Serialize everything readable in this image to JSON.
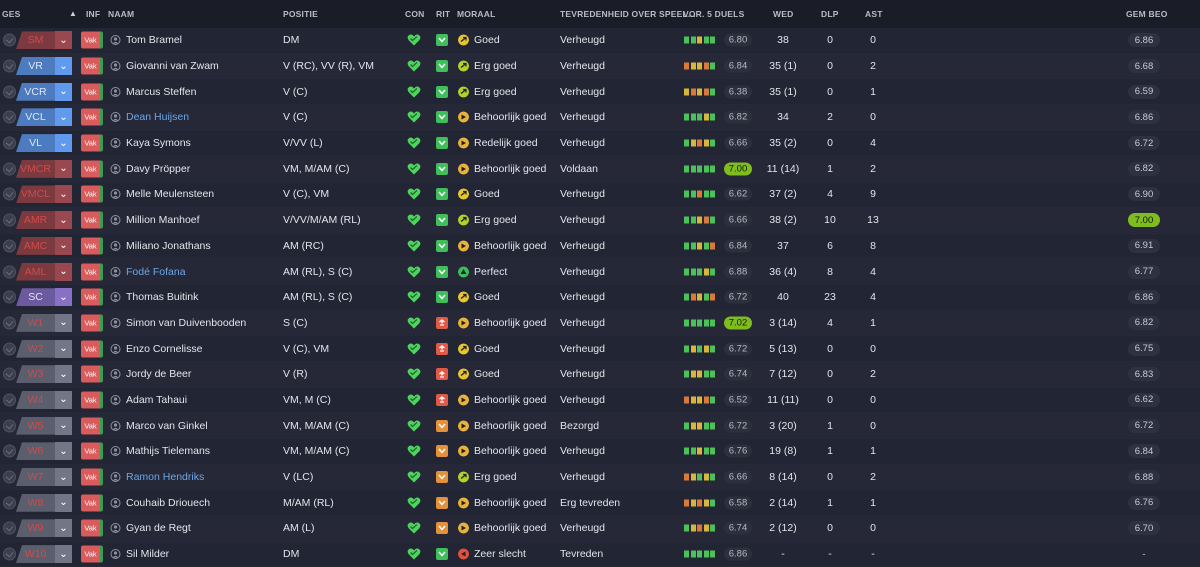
{
  "colors": {
    "pos_red": "#7b3a3f",
    "pos_blue": "#4d7bbf",
    "pos_purple": "#6c5a9e",
    "pos_grey": "#5b5e6c",
    "inf_red": "#d95b5b",
    "con_green": "#4fd35f",
    "rit_green": "#3fbf5a",
    "rit_red": "#e05a47",
    "rit_orange": "#e4913a",
    "morale_yellow": "#e6c52e",
    "morale_yellow_green": "#b4d12a",
    "morale_orange": "#e9b23a",
    "morale_green": "#38c060",
    "morale_red": "#e3503e",
    "form_green": "#4cc05a",
    "form_yellow": "#d9b53c",
    "form_orange": "#d97a3c",
    "highlight_rating": "#7fbd1e"
  },
  "header": {
    "ges": "GES",
    "inf": "INF",
    "naam": "NAAM",
    "positie": "POSITIE",
    "con": "CON",
    "rit": "RIT",
    "moraal": "MORAAL",
    "tevredenheid": "TEVREDENHEID OVER SPEEL...",
    "vor5": "VOR. 5 DUELS",
    "wed": "WED",
    "dlp": "DLP",
    "ast": "AST",
    "gem_beo": "GEM BEO"
  },
  "rows": [
    {
      "pos": "SM",
      "pos_color": "red",
      "inf": "Vak",
      "name": "Tom Bramel",
      "link": false,
      "positie": "DM",
      "rit": "green",
      "morale_icon": "yellow",
      "morale": "Goed",
      "tev": "Verheugd",
      "form": [
        "g",
        "g",
        "y",
        "g",
        "g"
      ],
      "form_rating": "6.80",
      "form_hi": false,
      "wed": "38",
      "dlp": "0",
      "ast": "0",
      "gem": "6.86",
      "gem_hi": false
    },
    {
      "pos": "VR",
      "pos_color": "blue",
      "inf": "Vak",
      "name": "Giovanni van Zwam",
      "link": false,
      "positie": "V (RC), VV (R), VM",
      "rit": "green",
      "morale_icon": "yellowgreen",
      "morale": "Erg goed",
      "tev": "Verheugd",
      "form": [
        "o",
        "y",
        "y",
        "o",
        "g"
      ],
      "form_rating": "6.84",
      "form_hi": false,
      "wed": "35 (1)",
      "dlp": "0",
      "ast": "2",
      "gem": "6.68",
      "gem_hi": false
    },
    {
      "pos": "VCR",
      "pos_color": "blue",
      "inf": "Vak",
      "name": "Marcus Steffen",
      "link": false,
      "positie": "V (C)",
      "rit": "green",
      "morale_icon": "yellowgreen",
      "morale": "Erg goed",
      "tev": "Verheugd",
      "form": [
        "y",
        "o",
        "y",
        "o",
        "g"
      ],
      "form_rating": "6.38",
      "form_hi": false,
      "wed": "35 (1)",
      "dlp": "0",
      "ast": "1",
      "gem": "6.59",
      "gem_hi": false
    },
    {
      "pos": "VCL",
      "pos_color": "blue",
      "inf": "Vak",
      "name": "Dean Huijsen",
      "link": true,
      "positie": "V (C)",
      "rit": "green",
      "morale_icon": "orange",
      "morale": "Behoorlijk goed",
      "tev": "Verheugd",
      "form": [
        "g",
        "g",
        "g",
        "y",
        "g"
      ],
      "form_rating": "6.82",
      "form_hi": false,
      "wed": "34",
      "dlp": "2",
      "ast": "0",
      "gem": "6.86",
      "gem_hi": false
    },
    {
      "pos": "VL",
      "pos_color": "blue",
      "inf": "Vak",
      "name": "Kaya Symons",
      "link": false,
      "positie": "V/VV (L)",
      "rit": "green",
      "morale_icon": "orange",
      "morale": "Redelijk goed",
      "tev": "Verheugd",
      "form": [
        "g",
        "y",
        "o",
        "y",
        "g"
      ],
      "form_rating": "6.66",
      "form_hi": false,
      "wed": "35 (2)",
      "dlp": "0",
      "ast": "4",
      "gem": "6.72",
      "gem_hi": false
    },
    {
      "pos": "VMCR",
      "pos_color": "red",
      "inf": "Vak",
      "name": "Davy Pröpper",
      "link": false,
      "positie": "VM, M/AM (C)",
      "rit": "green",
      "morale_icon": "orange",
      "morale": "Behoorlijk goed",
      "tev": "Voldaan",
      "form": [
        "g",
        "g",
        "g",
        "g",
        "g"
      ],
      "form_rating": "7.00",
      "form_hi": true,
      "wed": "11 (14)",
      "dlp": "1",
      "ast": "2",
      "gem": "6.82",
      "gem_hi": false
    },
    {
      "pos": "VMCL",
      "pos_color": "red",
      "inf": "Vak",
      "name": "Melle Meulensteen",
      "link": false,
      "positie": "V (C), VM",
      "rit": "green",
      "morale_icon": "yellow",
      "morale": "Goed",
      "tev": "Verheugd",
      "form": [
        "g",
        "g",
        "o",
        "g",
        "g"
      ],
      "form_rating": "6.62",
      "form_hi": false,
      "wed": "37 (2)",
      "dlp": "4",
      "ast": "9",
      "gem": "6.90",
      "gem_hi": false
    },
    {
      "pos": "AMR",
      "pos_color": "red",
      "inf": "Vak",
      "name": "Million Manhoef",
      "link": false,
      "positie": "V/VV/M/AM (RL)",
      "rit": "green",
      "morale_icon": "yellowgreen",
      "morale": "Erg goed",
      "tev": "Verheugd",
      "form": [
        "g",
        "g",
        "y",
        "o",
        "g"
      ],
      "form_rating": "6.66",
      "form_hi": false,
      "wed": "38 (2)",
      "dlp": "10",
      "ast": "13",
      "gem": "7.00",
      "gem_hi": true
    },
    {
      "pos": "AMC",
      "pos_color": "red",
      "inf": "Vak",
      "name": "Miliano Jonathans",
      "link": false,
      "positie": "AM (RC)",
      "rit": "green",
      "morale_icon": "orange",
      "morale": "Behoorlijk goed",
      "tev": "Verheugd",
      "form": [
        "g",
        "g",
        "y",
        "g",
        "o"
      ],
      "form_rating": "6.84",
      "form_hi": false,
      "wed": "37",
      "dlp": "6",
      "ast": "8",
      "gem": "6.91",
      "gem_hi": false
    },
    {
      "pos": "AML",
      "pos_color": "red",
      "inf": "Vak",
      "name": "Fodé Fofana",
      "link": true,
      "positie": "AM (RL), S (C)",
      "rit": "green",
      "morale_icon": "green",
      "morale": "Perfect",
      "tev": "Verheugd",
      "form": [
        "g",
        "g",
        "g",
        "y",
        "g"
      ],
      "form_rating": "6.88",
      "form_hi": false,
      "wed": "36 (4)",
      "dlp": "8",
      "ast": "4",
      "gem": "6.77",
      "gem_hi": false
    },
    {
      "pos": "SC",
      "pos_color": "purple",
      "inf": "Vak",
      "name": "Thomas Buitink",
      "link": false,
      "positie": "AM (RL), S (C)",
      "rit": "green",
      "morale_icon": "yellow",
      "morale": "Goed",
      "tev": "Verheugd",
      "form": [
        "g",
        "o",
        "y",
        "g",
        "o"
      ],
      "form_rating": "6.72",
      "form_hi": false,
      "wed": "40",
      "dlp": "23",
      "ast": "4",
      "gem": "6.86",
      "gem_hi": false
    },
    {
      "pos": "W1",
      "pos_color": "grey",
      "inf": "Vak",
      "name": "Simon van Duivenbooden",
      "link": false,
      "positie": "S (C)",
      "rit": "red",
      "morale_icon": "orange",
      "morale": "Behoorlijk goed",
      "tev": "Verheugd",
      "form": [
        "g",
        "g",
        "g",
        "g",
        "g"
      ],
      "form_rating": "7.02",
      "form_hi": true,
      "wed": "3 (14)",
      "dlp": "4",
      "ast": "1",
      "gem": "6.82",
      "gem_hi": false
    },
    {
      "pos": "W2",
      "pos_color": "grey",
      "inf": "Vak",
      "name": "Enzo Cornelisse",
      "link": false,
      "positie": "V (C), VM",
      "rit": "red",
      "morale_icon": "yellow",
      "morale": "Goed",
      "tev": "Verheugd",
      "form": [
        "g",
        "y",
        "g",
        "y",
        "g"
      ],
      "form_rating": "6.72",
      "form_hi": false,
      "wed": "5 (13)",
      "dlp": "0",
      "ast": "0",
      "gem": "6.75",
      "gem_hi": false
    },
    {
      "pos": "W3",
      "pos_color": "grey",
      "inf": "Vak",
      "name": "Jordy de Beer",
      "link": false,
      "positie": "V (R)",
      "rit": "red",
      "morale_icon": "yellow",
      "morale": "Goed",
      "tev": "Verheugd",
      "form": [
        "g",
        "y",
        "y",
        "g",
        "g"
      ],
      "form_rating": "6.74",
      "form_hi": false,
      "wed": "7 (12)",
      "dlp": "0",
      "ast": "2",
      "gem": "6.83",
      "gem_hi": false
    },
    {
      "pos": "W4",
      "pos_color": "grey",
      "inf": "Vak",
      "name": "Adam Tahaui",
      "link": false,
      "positie": "VM, M (C)",
      "rit": "red",
      "morale_icon": "orange",
      "morale": "Behoorlijk goed",
      "tev": "Verheugd",
      "form": [
        "o",
        "y",
        "y",
        "o",
        "g"
      ],
      "form_rating": "6.52",
      "form_hi": false,
      "wed": "11 (11)",
      "dlp": "0",
      "ast": "0",
      "gem": "6.62",
      "gem_hi": false
    },
    {
      "pos": "W5",
      "pos_color": "grey",
      "inf": "Vak",
      "name": "Marco van Ginkel",
      "link": false,
      "positie": "VM, M/AM (C)",
      "rit": "orange",
      "morale_icon": "orange",
      "morale": "Behoorlijk goed",
      "tev": "Bezorgd",
      "form": [
        "g",
        "y",
        "y",
        "g",
        "g"
      ],
      "form_rating": "6.72",
      "form_hi": false,
      "wed": "3 (20)",
      "dlp": "1",
      "ast": "0",
      "gem": "6.72",
      "gem_hi": false
    },
    {
      "pos": "W6",
      "pos_color": "grey",
      "inf": "Vak",
      "name": "Mathijs Tielemans",
      "link": false,
      "positie": "VM, M/AM (C)",
      "rit": "orange",
      "morale_icon": "orange",
      "morale": "Behoorlijk goed",
      "tev": "Verheugd",
      "form": [
        "g",
        "g",
        "y",
        "g",
        "g"
      ],
      "form_rating": "6.76",
      "form_hi": false,
      "wed": "19 (8)",
      "dlp": "1",
      "ast": "1",
      "gem": "6.84",
      "gem_hi": false
    },
    {
      "pos": "W7",
      "pos_color": "grey",
      "inf": "Vak",
      "name": "Ramon Hendriks",
      "link": true,
      "positie": "V (LC)",
      "rit": "orange",
      "morale_icon": "yellowgreen",
      "morale": "Erg goed",
      "tev": "Verheugd",
      "form": [
        "o",
        "y",
        "g",
        "y",
        "g"
      ],
      "form_rating": "6.66",
      "form_hi": false,
      "wed": "8 (14)",
      "dlp": "0",
      "ast": "2",
      "gem": "6.88",
      "gem_hi": false
    },
    {
      "pos": "W8",
      "pos_color": "grey",
      "inf": "Vak",
      "name": "Couhaib Driouech",
      "link": false,
      "positie": "M/AM (RL)",
      "rit": "orange",
      "morale_icon": "orange",
      "morale": "Behoorlijk goed",
      "tev": "Erg tevreden",
      "form": [
        "o",
        "y",
        "o",
        "y",
        "g"
      ],
      "form_rating": "6.58",
      "form_hi": false,
      "wed": "2 (14)",
      "dlp": "1",
      "ast": "1",
      "gem": "6.76",
      "gem_hi": false
    },
    {
      "pos": "W9",
      "pos_color": "grey",
      "inf": "Vak",
      "name": "Gyan de Regt",
      "link": false,
      "positie": "AM (L)",
      "rit": "orange",
      "morale_icon": "orange",
      "morale": "Behoorlijk goed",
      "tev": "Verheugd",
      "form": [
        "g",
        "y",
        "o",
        "y",
        "g"
      ],
      "form_rating": "6.74",
      "form_hi": false,
      "wed": "2 (12)",
      "dlp": "0",
      "ast": "0",
      "gem": "6.70",
      "gem_hi": false
    },
    {
      "pos": "W10",
      "pos_color": "grey",
      "inf": "Vak",
      "name": "Sil Milder",
      "link": false,
      "positie": "DM",
      "rit": "green",
      "morale_icon": "red",
      "morale": "Zeer slecht",
      "tev": "Tevreden",
      "form": [
        "g",
        "g",
        "g",
        "g",
        "g"
      ],
      "form_rating": "6.86",
      "form_hi": false,
      "wed": "-",
      "dlp": "-",
      "ast": "-",
      "gem": "-",
      "gem_hi": false
    }
  ]
}
